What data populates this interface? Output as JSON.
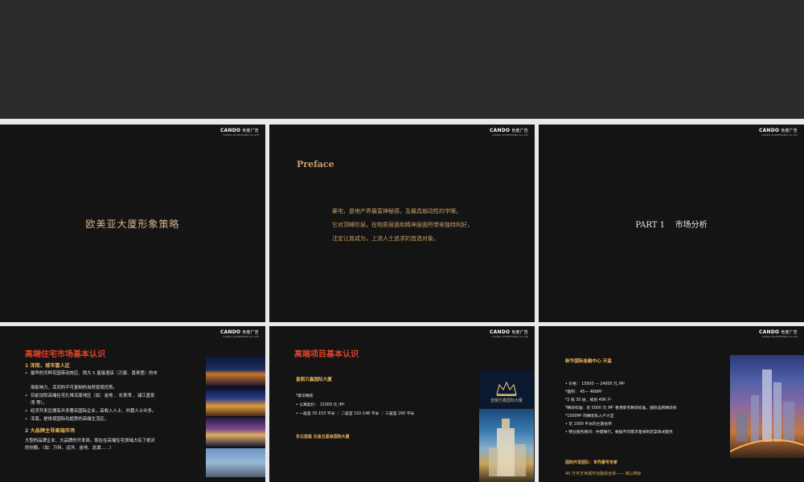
{
  "logo": {
    "brand": "CANDO",
    "brand_cn": "肯度广告",
    "sub": "CANDO ADVERTISING CO.,LTD"
  },
  "slides": {
    "s1": {
      "title": "欧美亚大厦形象策略"
    },
    "s2": {
      "title": "Preface",
      "lines": [
        "豪宅，是地产界最富神秘感，及最具煽动性的字眼。",
        "它对顶峰阶层，在物质层面和精神层面所带来独特利好，",
        "注定让其成为，上流人士追求的首选对象。"
      ]
    },
    "s3": {
      "title": "PART 1    市场分析"
    },
    "s4": {
      "title": "高端住宅市场基本认识",
      "h1": "1  浑南，城市富人区",
      "b1": "最早的河畔花园带动效应、两大 5 星级酒店（万豪、喜来登）的市",
      "b1b": "场影响力、浑河的不可复制的自然景观优势。",
      "b2": "目前沈阳高端住宅扎堆浑南地区（如：金地 、长青湾 、浦江盛景",
      "b2b": "湾 等）。",
      "b3": "经济开发区拥有众多著名国际企业，高收入人士、外籍人士众多。",
      "b4": "浑南，是体现国际化趋势的高端生活区。",
      "h2": "2  大品牌主导高端市场",
      "p1": "大型的品牌企业、大品牌的开发商，现在在高端住宅领域占有了绝对",
      "p2": "的份额。（如：万科、远洋、金地、龙湖……）"
    },
    "s5": {
      "title": "高端项目基本认识",
      "project": "皇朝万鑫国际大厦",
      "d0": "*豪华精装",
      "d1": "•  公寓起价：  21000 元 /M²",
      "d2": "•  一居室 35-153 平米 ｜ 二居室 102-148 平米 ｜ 三居室 200 平米",
      "foot": "东北首座 白金五星级国际大厦",
      "hotel_logo_text": "皇朝万鑫国际大厦"
    },
    "s6": {
      "h1": "新华国际金融中心 天玺",
      "d1": "•  价格：  15000 — 24000 元 /M²",
      "d2": "*面积：  45— 466M²",
      "d3": "*2 栋 30 层，规划 496 户",
      "d4": "*精装标准：近 5000 元 /M² 香港豪宅精装标准，国际品牌精装修",
      "d5": "*1000M² 的精装私人户大堂",
      "d6": "•  近 2000 平米的主题会所",
      "d7": "•  物业服务顾问：仲量联行。根据不同需求量身制定菜单式服务",
      "h2": "国际开发团队：世界豪宅专家",
      "h3": "40 万平方米城市功能综合体—— 城心地标"
    }
  }
}
